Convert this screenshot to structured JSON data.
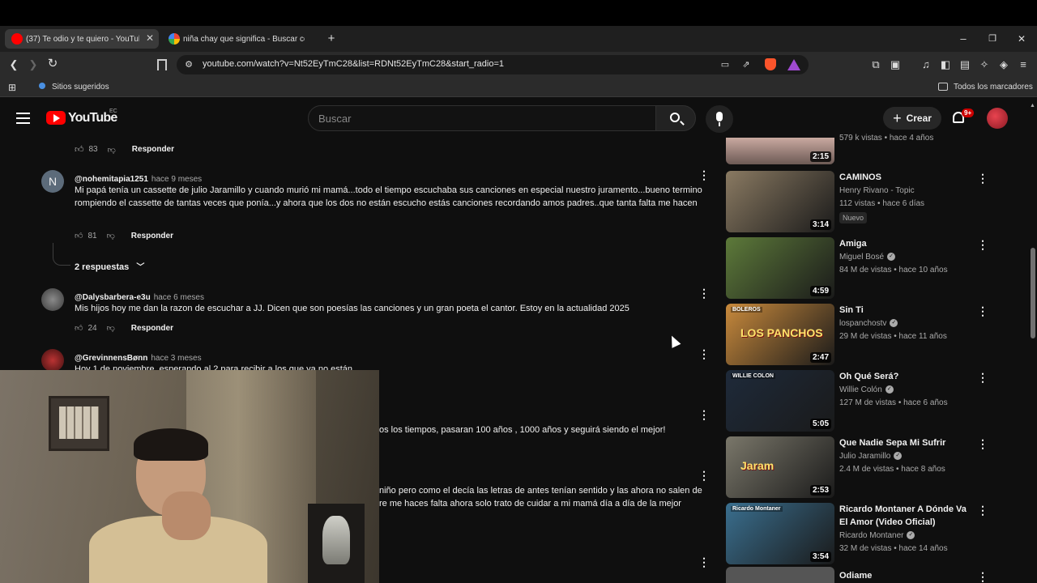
{
  "browser": {
    "tabs": [
      {
        "title": "(37) Te odio y te quiero - YouTube",
        "active": true
      },
      {
        "title": "niña chay que significa - Buscar con Google",
        "active": false
      }
    ],
    "new_tab": "+",
    "url": "youtube.com/watch?v=Nt52EyTmC28&list=RDNt52EyTmC28&start_radio=1",
    "bookmarks": {
      "suggested": "Sitios sugeridos",
      "all": "Todos los marcadores"
    },
    "window_controls": {
      "minimize": "–",
      "restore": "❐",
      "close": "✕"
    }
  },
  "youtube": {
    "logo_text": "YouTube",
    "country": "EC",
    "search_placeholder": "Buscar",
    "create_label": "Crear",
    "notif_count": "9+"
  },
  "comments": {
    "top_likes": "83",
    "reply_label": "Responder",
    "items": [
      {
        "avatar_letter": "N",
        "author": "@nohemitapia1251",
        "time": "hace 9 meses",
        "text": "Mi papá tenía un cassette de julio Jaramillo y cuando murió mi mamá...todo el tiempo escuchaba sus canciones en especial nuestro juramento...bueno termino rompiendo el cassette de tantas veces que ponía...y ahora que los dos no están escucho estás canciones recordando amos padres..que tanta falta me hacen",
        "likes": "81",
        "replies": "2 respuestas"
      },
      {
        "author": "@Dalysbarbera-e3u",
        "time": "hace 6 meses",
        "text": "Mis hijos hoy me dan la razon de escuchar a JJ. Dicen que son poesías las canciones y un  gran poeta el cantor. Estoy en la actualidad 2025",
        "likes": "24"
      },
      {
        "author": "@GrevinnensBønn",
        "time": "hace 3 meses",
        "text": "Hoy 1 de noviembre, esperando al 2 para recibir a los que ya no están"
      },
      {
        "text": "os los tiempos, pasaran 100 años , 1000 años y seguirá siendo el mejor!"
      },
      {
        "text": "niño pero como el decía las letras de antes tenían sentido y las ahora no salen de",
        "text2": "re me haces falta ahora solo trato de cuidar a mi mamá día a día de la mejor"
      }
    ]
  },
  "sidebar": {
    "top_stats": "579 k vistas • hace 4 años",
    "top_duration": "2:15",
    "videos": [
      {
        "title": "CAMINOS",
        "channel": "Henry Rivano - Topic",
        "stats": "112 vistas • hace 6 días",
        "badge": "Nuevo",
        "duration": "3:14",
        "verified": false,
        "color": "#8a7a62"
      },
      {
        "title": "Amiga",
        "channel": "Miguel Bosé",
        "stats": "84 M de vistas • hace 10 años",
        "duration": "4:59",
        "verified": true,
        "color": "#5d7a3a"
      },
      {
        "title": "Sin Ti",
        "channel": "lospanchostv",
        "stats": "29 M de vistas • hace 11 años",
        "duration": "2:47",
        "verified": true,
        "color": "#c98a3c",
        "thumb_text": "LOS PANCHOS",
        "thumb_top": "BOLEROS"
      },
      {
        "title": "Oh Qué Será?",
        "channel": "Willie Colón",
        "stats": "127 M de vistas • hace 6 años",
        "duration": "5:05",
        "verified": true,
        "color": "#1e2a3a",
        "thumb_top": "WILLIE COLON"
      },
      {
        "title": "Que Nadie Sepa Mi Sufrir",
        "channel": "Julio Jaramillo",
        "stats": "2.4 M de vistas • hace 8 años",
        "duration": "2:53",
        "verified": true,
        "color": "#7a776a",
        "thumb_text": "Jaram"
      },
      {
        "title": "Ricardo Montaner A Dónde Va El Amor (Video Oficial)",
        "channel": "Ricardo Montaner",
        "stats": "32 M de vistas • hace 14 años",
        "duration": "3:54",
        "verified": true,
        "color": "#3a6f8f",
        "thumb_top": "Ricardo Montaner"
      },
      {
        "title": "Odiame",
        "channel": "",
        "stats": "",
        "duration": "",
        "verified": false,
        "color": "#555"
      }
    ]
  }
}
